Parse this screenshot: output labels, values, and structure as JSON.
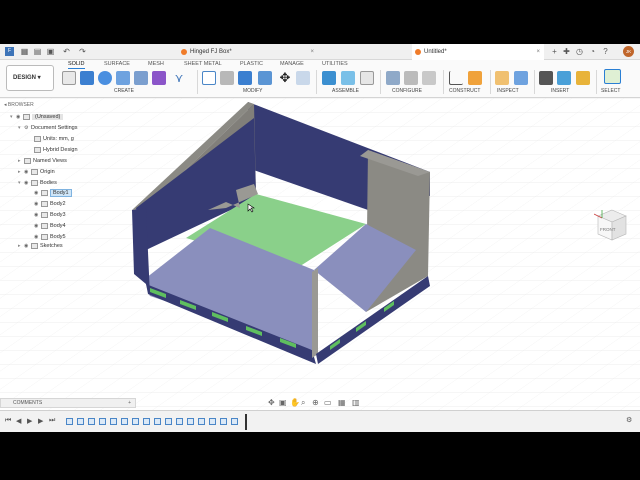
{
  "titlebar": {
    "tabs": [
      {
        "label": "Hinged FJ Box*",
        "active": false
      },
      {
        "label": "Untitled*",
        "active": true
      }
    ],
    "user_initials": "JK"
  },
  "toolbar": {
    "workspace_label": "DESIGN",
    "workspace_tabs": [
      "SOLID",
      "SURFACE",
      "MESH",
      "SHEET METAL",
      "PLASTIC",
      "MANAGE",
      "UTILITIES"
    ],
    "active_tab": "SOLID",
    "groups": [
      "CREATE",
      "MODIFY",
      "ASSEMBLE",
      "CONFIGURE",
      "CONSTRUCT",
      "INSPECT",
      "INSERT",
      "SELECT"
    ]
  },
  "browser": {
    "header": "BROWSER",
    "items": [
      {
        "label": "(Unsaved)"
      },
      {
        "label": "Document Settings"
      },
      {
        "label": "Units: mm, g"
      },
      {
        "label": "Hybrid Design"
      },
      {
        "label": "Named Views"
      },
      {
        "label": "Origin"
      },
      {
        "label": "Bodies"
      },
      {
        "label": "Body1"
      },
      {
        "label": "Body2"
      },
      {
        "label": "Body3"
      },
      {
        "label": "Body4"
      },
      {
        "label": "Body5"
      },
      {
        "label": "Sketches"
      }
    ]
  },
  "viewcube": {
    "face_label": "FRONT"
  },
  "comments": {
    "label": "COMMENTS"
  },
  "colors": {
    "accent": "#2a7fd4",
    "navy_panel": "#363b73",
    "lavender_panel": "#8a8fbd",
    "green_floor": "#8ad08a",
    "wall_gray": "#8b8a84"
  }
}
